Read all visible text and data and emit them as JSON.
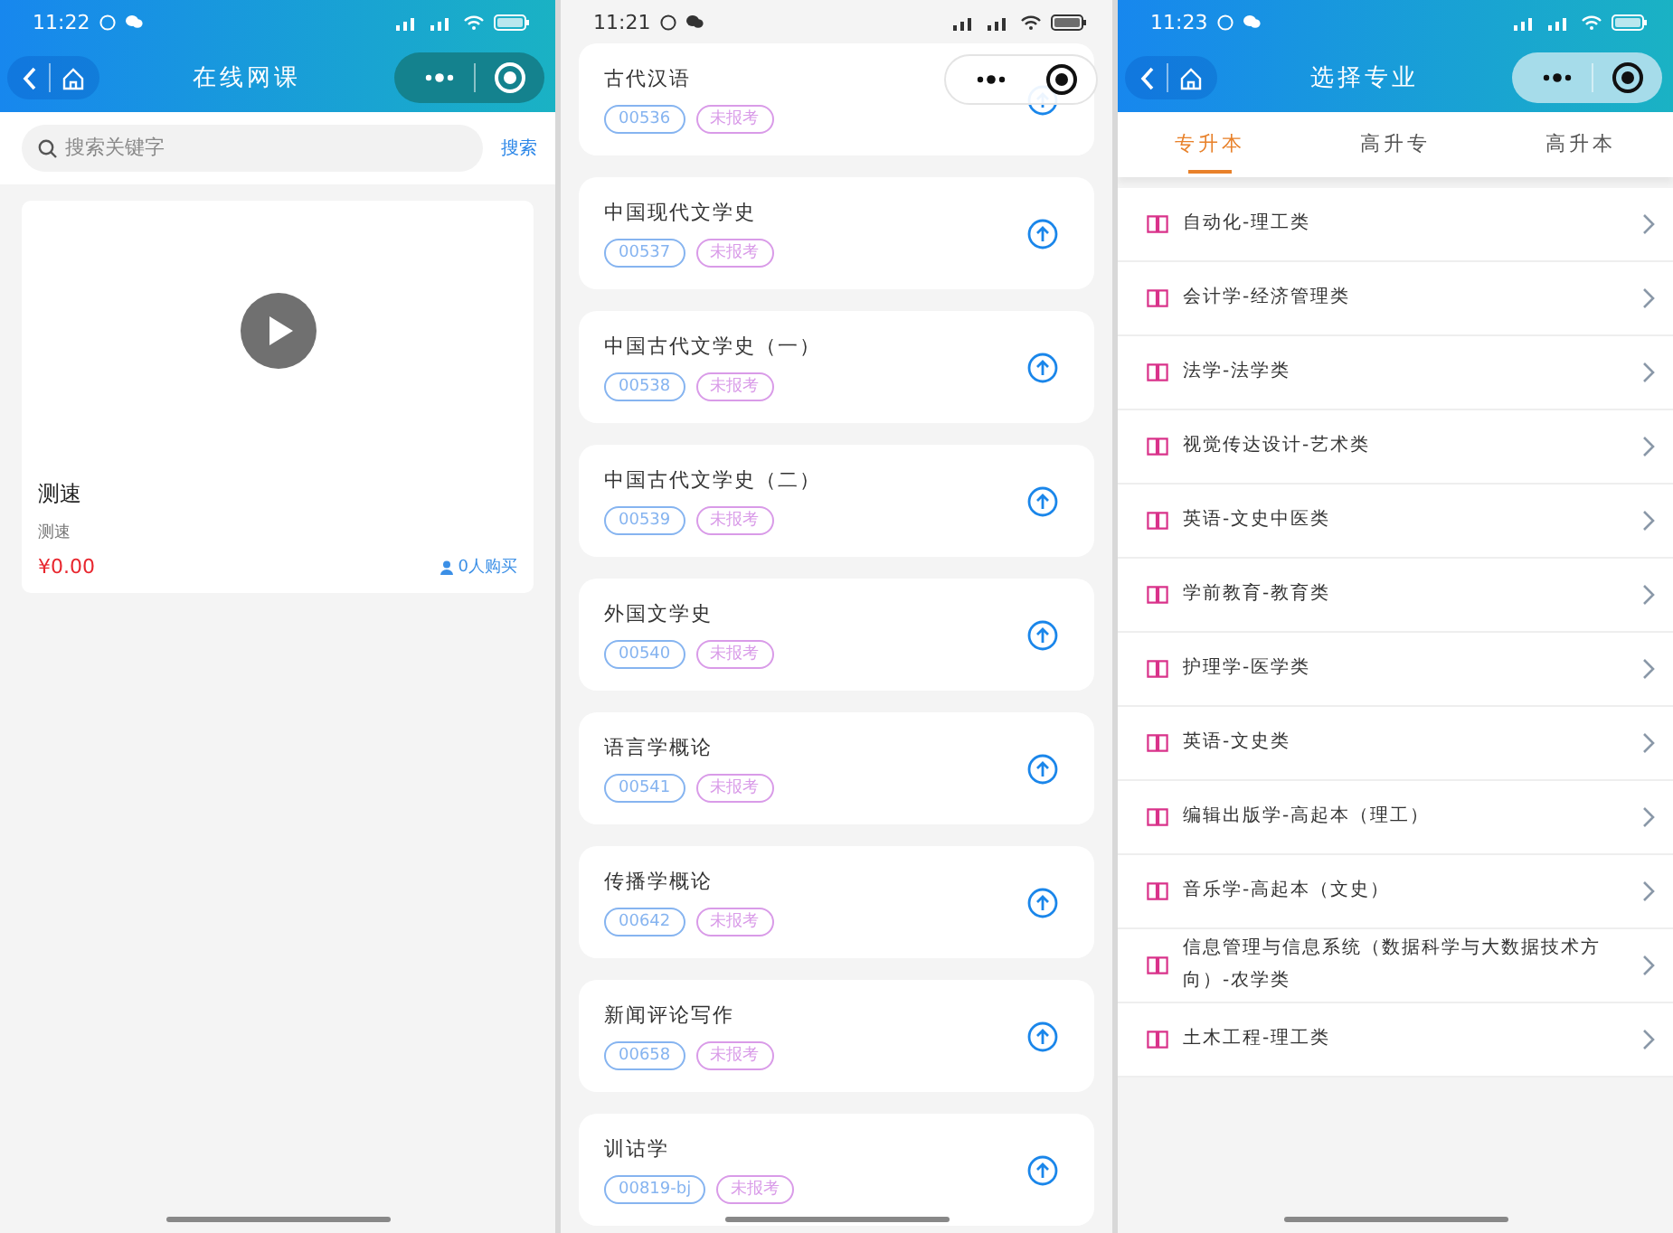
{
  "course_screen": {
    "status_bar": {
      "time": "11:22"
    },
    "nav": {
      "title": "在线网课"
    },
    "search": {
      "placeholder": "搜索关键字",
      "button": "搜索"
    },
    "courses": [
      {
        "title": "测速",
        "subtitle": "测速",
        "price": "¥0.00",
        "buyers": "0人购买"
      }
    ]
  },
  "subjects_screen": {
    "status_bar": {
      "time": "11:21"
    },
    "subjects": [
      {
        "name": "古代汉语",
        "code": "00536",
        "status": "未报考"
      },
      {
        "name": "中国现代文学史",
        "code": "00537",
        "status": "未报考"
      },
      {
        "name": "中国古代文学史（一）",
        "code": "00538",
        "status": "未报考"
      },
      {
        "name": "中国古代文学史（二）",
        "code": "00539",
        "status": "未报考"
      },
      {
        "name": "外国文学史",
        "code": "00540",
        "status": "未报考"
      },
      {
        "name": "语言学概论",
        "code": "00541",
        "status": "未报考"
      },
      {
        "name": "传播学概论",
        "code": "00642",
        "status": "未报考"
      },
      {
        "name": "新闻评论写作",
        "code": "00658",
        "status": "未报考"
      },
      {
        "name": "训诂学",
        "code": "00819-bj",
        "status": "未报考"
      }
    ]
  },
  "majors_screen": {
    "status_bar": {
      "time": "11:23"
    },
    "nav": {
      "title": "选择专业"
    },
    "tabs": [
      {
        "label": "专升本",
        "selected": true
      },
      {
        "label": "高升专",
        "selected": false
      },
      {
        "label": "高升本",
        "selected": false
      }
    ],
    "majors": [
      "自动化-理工类",
      "会计学-经济管理类",
      "法学-法学类",
      "视觉传达设计-艺术类",
      "英语-文史中医类",
      "学前教育-教育类",
      "护理学-医学类",
      "英语-文史类",
      "编辑出版学-高起本（理工）",
      "音乐学-高起本（文史）",
      "信息管理与信息系统（数据科学与大数据技术方向）-农学类",
      "土木工程-理工类"
    ]
  }
}
